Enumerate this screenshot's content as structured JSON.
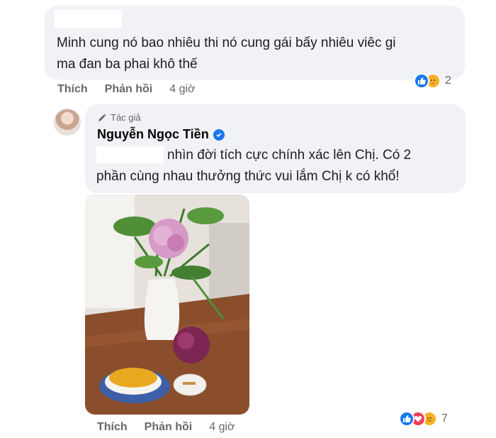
{
  "comment1": {
    "text_line1": "Minh cung nó bao nhiêu thi nó cung gái bấy nhiêu viêc gi",
    "text_line2": "ma đan ba phai khô thế",
    "actions": {
      "like": "Thích",
      "reply": "Phản hồi",
      "time": "4 giờ"
    },
    "reaction_count": "2",
    "reaction_icons": [
      "like-icon",
      "care-icon"
    ]
  },
  "comment2": {
    "author_badge": "Tác giả",
    "author_name": "Nguyễn Ngọc Tiền",
    "verified": true,
    "text_line1": "nhìn đời tích cực chính xác lên Chị. Có 2",
    "text_line2": "phần cùng nhau thưởng thức vui lắm Chị k có khổ!",
    "attachment": "photo of pink and purple peonies in a white vase on a wooden table beside a cup of yellow soup and a small dish",
    "actions": {
      "like": "Thích",
      "reply": "Phản hồi",
      "time": "4 giờ"
    },
    "reaction_count": "7",
    "reaction_icons": [
      "like-icon",
      "love-icon",
      "sad-icon"
    ]
  },
  "colors": {
    "bubble": "#f0f2f5",
    "like_blue": "#1877f2",
    "love_red": "#f33e58",
    "reaction_yellow": "#f7b125",
    "meta_gray": "#65676b"
  }
}
